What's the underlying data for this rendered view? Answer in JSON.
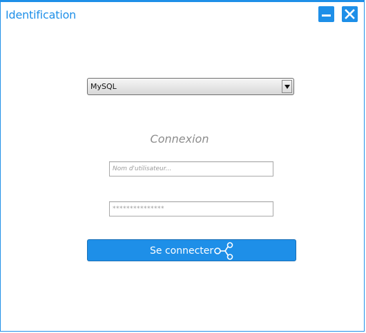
{
  "window": {
    "title": "Identification",
    "accent_color": "#1e8fe8"
  },
  "database_select": {
    "selected": "MySQL"
  },
  "form": {
    "heading": "Connexion",
    "username_placeholder": "Nom d'utilisateur...",
    "password_value": "***************",
    "connect_label": "Se connecter",
    "connect_icon": "share-nodes-icon"
  }
}
